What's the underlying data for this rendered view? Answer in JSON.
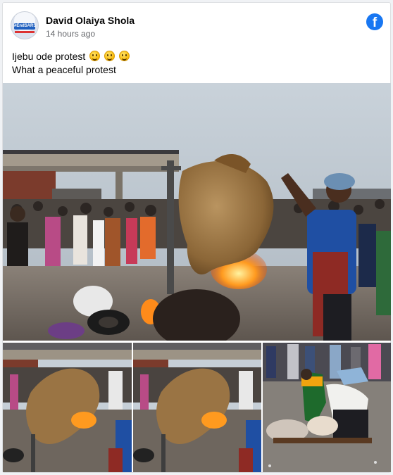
{
  "post": {
    "author": "David Olaiya Shola",
    "time": "14 hours ago",
    "avatar_badge": "#EndSARS",
    "caption_lines": [
      "Ijebu ode protest",
      "What a peaceful protest"
    ],
    "caption_emoji_count": 3,
    "emoji_icon": "grinning-face-emoji",
    "brand_icon": "facebook-icon",
    "brand_color": "#1877f2"
  },
  "photos": {
    "main": "roasting-carcass-crowd-photo",
    "thumbs": [
      "roasting-carcass-crowd-photo",
      "roasting-carcass-crowd-photo",
      "butchering-on-ground-photo"
    ]
  }
}
